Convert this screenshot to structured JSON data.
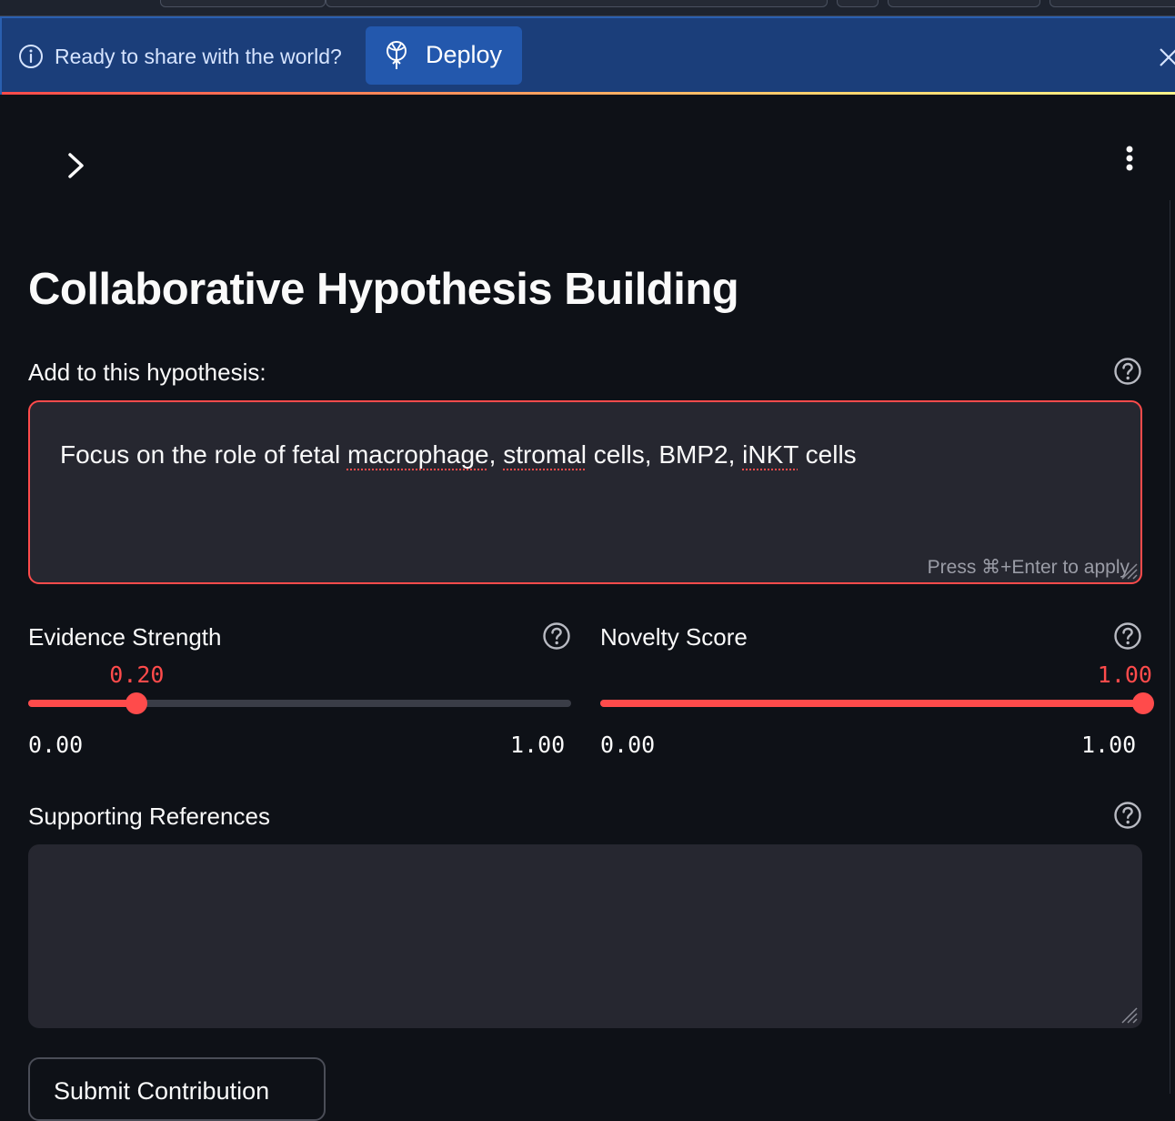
{
  "banner": {
    "message": "Ready to share with the world?",
    "deploy_label": "Deploy"
  },
  "page": {
    "title": "Collaborative Hypothesis Building"
  },
  "hypothesis_input": {
    "label": "Add to this hypothesis:",
    "value_parts": [
      "Focus on the role of fetal ",
      "macrophage",
      ", ",
      "stromal",
      " cells, BMP2, ",
      "iNKT",
      " cells"
    ],
    "hint": "Press ⌘+Enter to apply"
  },
  "evidence_slider": {
    "label": "Evidence Strength",
    "value": 0.2,
    "value_text": "0.20",
    "min_text": "0.00",
    "max_text": "1.00"
  },
  "novelty_slider": {
    "label": "Novelty Score",
    "value": 1.0,
    "value_text": "1.00",
    "min_text": "0.00",
    "max_text": "1.00"
  },
  "references_input": {
    "label": "Supporting References",
    "value": ""
  },
  "submit_label": "Submit Contribution",
  "colors": {
    "accent": "#ff4b4b",
    "background": "#0e1117",
    "input_bg": "#262730",
    "banner_bg": "#1b3e7a",
    "deploy_bg": "#2358ad"
  },
  "icons": {
    "info": "info-circle-icon",
    "deploy": "rocket-icon",
    "close": "close-icon",
    "sidebar_toggle": "chevron-right-icon",
    "menu": "kebab-menu-icon",
    "help": "question-circle-icon"
  }
}
